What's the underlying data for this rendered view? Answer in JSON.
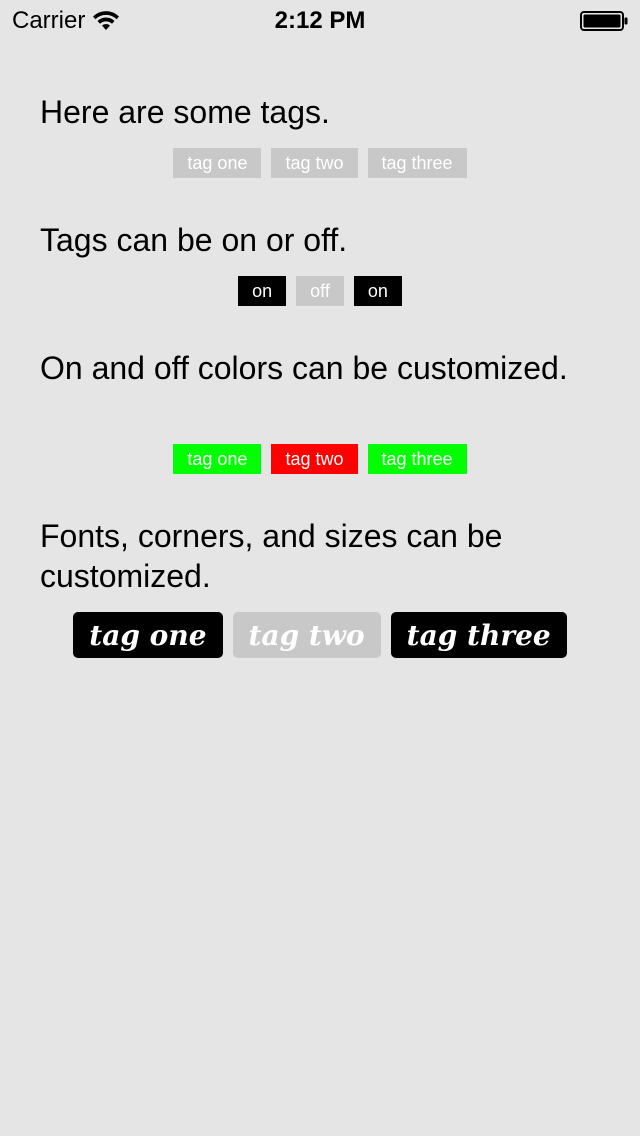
{
  "status_bar": {
    "carrier": "Carrier",
    "time": "2:12 PM",
    "icons": [
      "wifi-icon",
      "battery-icon"
    ]
  },
  "sections": [
    {
      "heading": "Here are some tags.",
      "tags": [
        "tag one",
        "tag two",
        "tag three"
      ]
    },
    {
      "heading": "Tags can be on or off.",
      "tags": [
        "on",
        "off",
        "on"
      ],
      "states": [
        "on",
        "off",
        "on"
      ]
    },
    {
      "heading": "On and off colors can be customized.",
      "tags": [
        "tag one",
        "tag two",
        "tag three"
      ],
      "states": [
        "on",
        "off",
        "on"
      ],
      "on_color": "#00ff00",
      "off_color": "#ff0000"
    },
    {
      "heading": "Fonts, corners, and sizes can be customized.",
      "tags": [
        "tag one",
        "tag two",
        "tag three"
      ],
      "states": [
        "on",
        "off",
        "on"
      ],
      "on_color": "#000000",
      "off_color": "#c8c8c8"
    }
  ],
  "colors": {
    "background": "#e5e5e5",
    "tag_default": "#c8c8c8",
    "tag_on": "#000000",
    "tag_text": "#ffffff"
  }
}
